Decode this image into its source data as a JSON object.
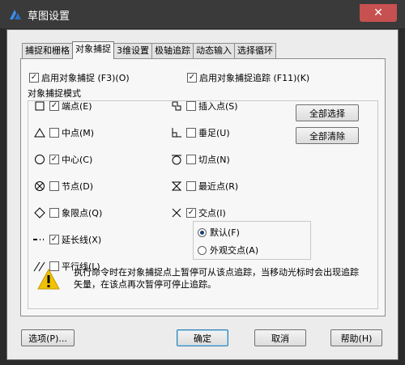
{
  "window": {
    "title": "草图设置",
    "close_glyph": "✕"
  },
  "tabs": [
    "捕捉和栅格",
    "对象捕捉",
    "3维设置",
    "极轴追踪",
    "动态输入",
    "选择循环"
  ],
  "enable_snap": {
    "label": "启用对象捕捉 (F3)(O)",
    "checked": true
  },
  "enable_tracking": {
    "label": "启用对象捕捉追踪 (F11)(K)",
    "checked": true
  },
  "group_title": "对象捕捉模式",
  "left_modes": [
    {
      "icon": "square-endpoint-icon",
      "label": "端点(E)",
      "checked": true
    },
    {
      "icon": "triangle-midpoint-icon",
      "label": "中点(M)",
      "checked": false
    },
    {
      "icon": "circle-center-icon",
      "label": "中心(C)",
      "checked": true
    },
    {
      "icon": "node-icon",
      "label": "节点(D)",
      "checked": false
    },
    {
      "icon": "diamond-quadrant-icon",
      "label": "象限点(Q)",
      "checked": false
    },
    {
      "icon": "extension-icon",
      "label": "延长线(X)",
      "checked": true
    },
    {
      "icon": "parallel-icon",
      "label": "平行线(L)",
      "checked": false
    }
  ],
  "right_modes": [
    {
      "icon": "insertion-icon",
      "label": "插入点(S)",
      "checked": false
    },
    {
      "icon": "perpendicular-icon",
      "label": "垂足(U)",
      "checked": false
    },
    {
      "icon": "tangent-icon",
      "label": "切点(N)",
      "checked": false
    },
    {
      "icon": "nearest-icon",
      "label": "最近点(R)",
      "checked": false
    },
    {
      "icon": "intersection-icon",
      "label": "交点(I)",
      "checked": true
    }
  ],
  "select_all": "全部选择",
  "clear_all": "全部清除",
  "radios": [
    {
      "label": "默认(F)",
      "selected": true
    },
    {
      "label": "外观交点(A)",
      "selected": false
    }
  ],
  "tip": "执行命令时在对象捕捉点上暂停可从该点追踪，当移动光标时会出现追踪矢量，在该点再次暂停可停止追踪。",
  "footer": {
    "options": "选项(P)...",
    "ok": "确定",
    "cancel": "取消",
    "help": "帮助(H)"
  }
}
